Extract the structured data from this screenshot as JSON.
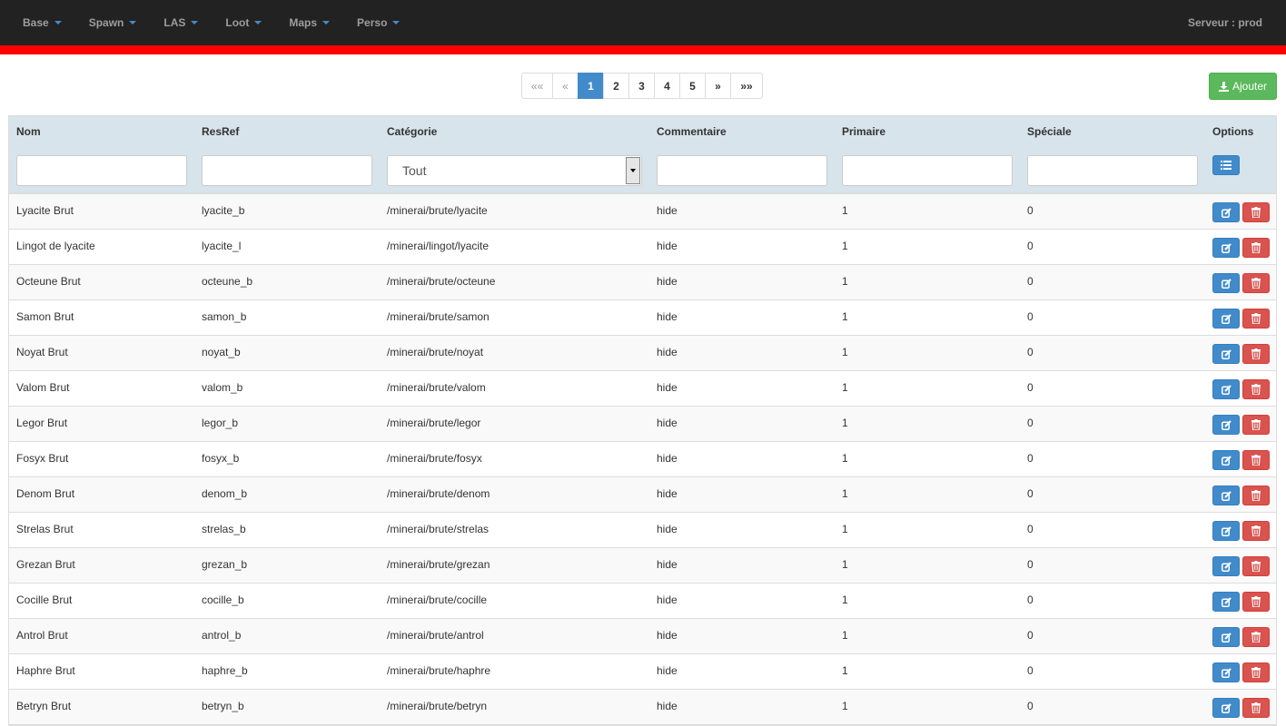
{
  "nav": {
    "items": [
      {
        "label": "Base"
      },
      {
        "label": "Spawn"
      },
      {
        "label": "LAS"
      },
      {
        "label": "Loot"
      },
      {
        "label": "Maps"
      },
      {
        "label": "Perso"
      }
    ],
    "server": "Serveur : prod"
  },
  "pagination": {
    "first": "««",
    "prev": "«",
    "pages": [
      "1",
      "2",
      "3",
      "4",
      "5"
    ],
    "current": "1",
    "next": "»",
    "last": "»»"
  },
  "add_button": {
    "label": "Ajouter",
    "icon": "download-icon"
  },
  "colors": {
    "navbar": "#222222",
    "accent_bar": "#ff0000",
    "primary": "#428bca",
    "success": "#5cb85c",
    "danger": "#d9534f",
    "header_bg": "#d7e4eb"
  },
  "table": {
    "columns": [
      "Nom",
      "ResRef",
      "Catégorie",
      "Commentaire",
      "Primaire",
      "Spéciale",
      "Options"
    ],
    "filters": {
      "categorie_selected": "Tout"
    },
    "rows": [
      [
        "Lyacite Brut",
        "lyacite_b",
        "/minerai/brute/lyacite",
        "hide",
        "1",
        "0"
      ],
      [
        "Lingot de lyacite",
        "lyacite_l",
        "/minerai/lingot/lyacite",
        "hide",
        "1",
        "0"
      ],
      [
        "Octeune Brut",
        "octeune_b",
        "/minerai/brute/octeune",
        "hide",
        "1",
        "0"
      ],
      [
        "Samon Brut",
        "samon_b",
        "/minerai/brute/samon",
        "hide",
        "1",
        "0"
      ],
      [
        "Noyat Brut",
        "noyat_b",
        "/minerai/brute/noyat",
        "hide",
        "1",
        "0"
      ],
      [
        "Valom Brut",
        "valom_b",
        "/minerai/brute/valom",
        "hide",
        "1",
        "0"
      ],
      [
        "Legor Brut",
        "legor_b",
        "/minerai/brute/legor",
        "hide",
        "1",
        "0"
      ],
      [
        "Fosyx Brut",
        "fosyx_b",
        "/minerai/brute/fosyx",
        "hide",
        "1",
        "0"
      ],
      [
        "Denom Brut",
        "denom_b",
        "/minerai/brute/denom",
        "hide",
        "1",
        "0"
      ],
      [
        "Strelas Brut",
        "strelas_b",
        "/minerai/brute/strelas",
        "hide",
        "1",
        "0"
      ],
      [
        "Grezan Brut",
        "grezan_b",
        "/minerai/brute/grezan",
        "hide",
        "1",
        "0"
      ],
      [
        "Cocille Brut",
        "cocille_b",
        "/minerai/brute/cocille",
        "hide",
        "1",
        "0"
      ],
      [
        "Antrol Brut",
        "antrol_b",
        "/minerai/brute/antrol",
        "hide",
        "1",
        "0"
      ],
      [
        "Haphre Brut",
        "haphre_b",
        "/minerai/brute/haphre",
        "hide",
        "1",
        "0"
      ],
      [
        "Betryn Brut",
        "betryn_b",
        "/minerai/brute/betryn",
        "hide",
        "1",
        "0"
      ]
    ]
  }
}
